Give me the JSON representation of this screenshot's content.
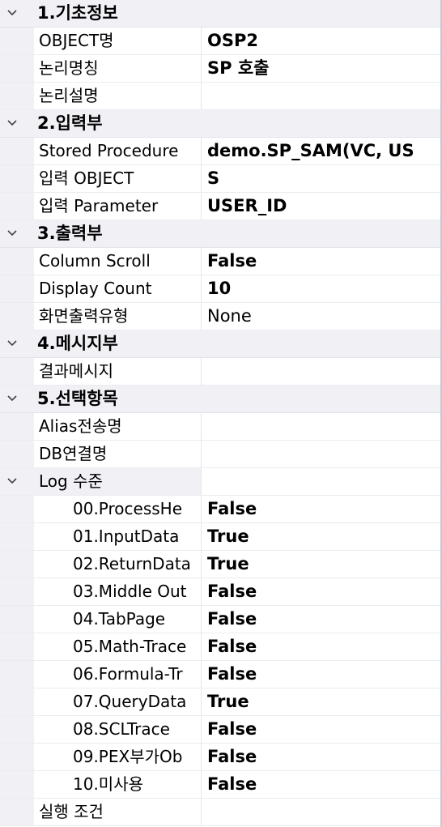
{
  "categories": [
    {
      "title": "1.기초정보",
      "props": [
        {
          "name": "OBJECT명",
          "value": "OSP2",
          "bold": true
        },
        {
          "name": "논리명칭",
          "value": "SP 호출",
          "bold": true
        },
        {
          "name": "논리설명",
          "value": "",
          "bold": false
        }
      ]
    },
    {
      "title": "2.입력부",
      "props": [
        {
          "name": "Stored Procedure",
          "value": "demo.SP_SAM(VC, US",
          "bold": true
        },
        {
          "name": "입력 OBJECT",
          "value": "S",
          "bold": true
        },
        {
          "name": "입력 Parameter",
          "value": "USER_ID",
          "bold": true
        }
      ]
    },
    {
      "title": "3.출력부",
      "props": [
        {
          "name": "Column Scroll",
          "value": "False",
          "bold": true
        },
        {
          "name": "Display Count",
          "value": "10",
          "bold": true
        },
        {
          "name": "화면출력유형",
          "value": "None",
          "bold": false
        }
      ]
    },
    {
      "title": "4.메시지부",
      "props": [
        {
          "name": "결과메시지",
          "value": "",
          "bold": false
        }
      ]
    },
    {
      "title": "5.선택항목",
      "props": [
        {
          "name": "Alias전송명",
          "value": "",
          "bold": false
        },
        {
          "name": "DB연결명",
          "value": "",
          "bold": false
        }
      ]
    }
  ],
  "log_group": {
    "name": "Log 수준",
    "items": [
      {
        "name": "00.ProcessHe",
        "value": "False"
      },
      {
        "name": "01.InputData",
        "value": "True"
      },
      {
        "name": "02.ReturnData",
        "value": "True"
      },
      {
        "name": "03.Middle Out",
        "value": "False"
      },
      {
        "name": "04.TabPage",
        "value": "False"
      },
      {
        "name": "05.Math-Trace",
        "value": "False"
      },
      {
        "name": "06.Formula-Tr",
        "value": "False"
      },
      {
        "name": "07.QueryData",
        "value": "True"
      },
      {
        "name": "08.SCLTrace",
        "value": "False"
      },
      {
        "name": "09.PEX부가Ob",
        "value": "False"
      },
      {
        "name": "10.미사용",
        "value": "False"
      }
    ]
  },
  "trailing_prop": {
    "name": "실행 조건",
    "value": ""
  },
  "icons": {
    "expander": "chevron-down-icon"
  },
  "colors": {
    "gutter": "#f0f0f5",
    "category_bg": "#f0f0f5",
    "grid_line": "#ebecf0"
  }
}
